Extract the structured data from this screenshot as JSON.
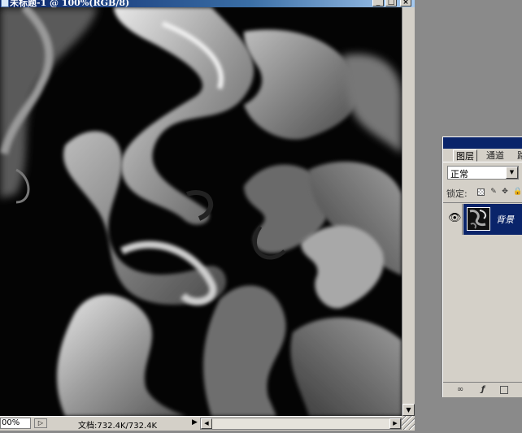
{
  "window": {
    "title": "未标题-1 @ 100%(RGB/8)",
    "caption_min": "_",
    "caption_max": "□",
    "caption_close": "×"
  },
  "statusbar": {
    "zoom": "00%",
    "doc_size": "文档:732.4K/732.4K",
    "arrow": "▶",
    "scroll_left": "◀",
    "scroll_right": "▶",
    "menu": "▷"
  },
  "vscroll": {
    "down": "▼"
  },
  "layers_panel": {
    "tabs": [
      "图层",
      "通道",
      "路"
    ],
    "blend_mode": "正常",
    "blend_arrow": "▼",
    "lock_label": "锁定:",
    "lock_brush": "✎",
    "lock_move": "✥",
    "lock_all": "🔒",
    "eye": "👁",
    "layer_name": "背景",
    "link_icon": "∞",
    "fx_icon": "ƒ"
  },
  "icons": {
    "app": "photoshop-document-icon",
    "eye": "eye-icon",
    "link": "link-icon",
    "fx": "layer-style-icon",
    "new_layer": "new-layer-icon"
  }
}
